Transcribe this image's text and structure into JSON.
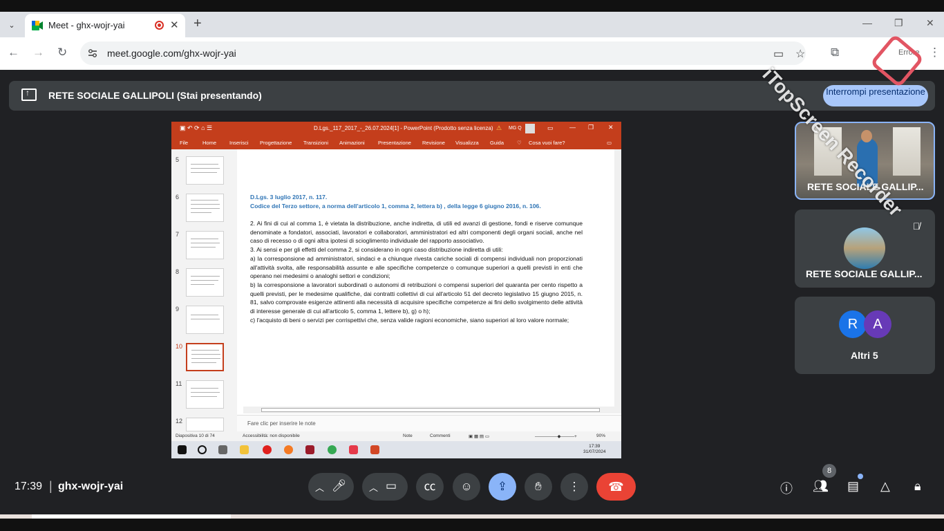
{
  "browser": {
    "tab_title": "Meet - ghx-wojr-yai",
    "url": "meet.google.com/ghx-wojr-yai",
    "profile_label": "Errore"
  },
  "meet": {
    "presenting_banner": "RETE SOCIALE GALLIPOLI (Stai presentando)",
    "stop_presenting": "Interrompi presentazione",
    "time": "17:39",
    "meeting_code": "ghx-wojr-yai",
    "participants_count": "8",
    "participants": [
      {
        "name": "RETE SOCIALE GALLIP..."
      },
      {
        "name": "RETE SOCIALE GALLIP..."
      }
    ],
    "others": {
      "label": "Altri 5",
      "avatars": [
        "R",
        "A"
      ]
    }
  },
  "shared_screen": {
    "window_title": "D.Lgs._117_2017_-_26.07.2024[1] - PowerPoint (Prodotto senza licenza)",
    "user_initials": "MG Q",
    "ribbon_tabs": [
      "File",
      "Home",
      "Inserisci",
      "Progettazione",
      "Transizioni",
      "Animazioni",
      "Presentazione",
      "Revisione",
      "Visualizza",
      "Guida",
      "Cosa vuoi fare?"
    ],
    "thumb_numbers": [
      "5",
      "6",
      "7",
      "8",
      "9",
      "10",
      "11",
      "12"
    ],
    "slide_heading_1": "D.Lgs. 3 luglio 2017, n. 117.",
    "slide_heading_2": "Codice del Terzo settore, a norma dell'articolo 1, comma 2, lettera b) , della legge 6 giugno 2016, n. 106.",
    "slide_body": [
      "2. Ai fini di cui al comma 1, è vietata la distribuzione, anche indiretta, di utili ed avanzi di gestione, fondi e riserve comunque denominate a fondatori, associati, lavoratori e collaboratori, amministratori ed altri componenti degli organi sociali, anche nel caso di recesso o di ogni altra ipotesi di scioglimento individuale del rapporto associativo.",
      "3. Ai sensi e per gli effetti del comma 2, si considerano in ogni caso distribuzione indiretta di utili:",
      "a) la corresponsione ad amministratori, sindaci e a chiunque rivesta cariche sociali di compensi individuali non proporzionati all'attività svolta, alle responsabilità assunte e alle specifiche competenze o comunque superiori a quelli previsti in enti che operano nei medesimi o analoghi settori e condizioni;",
      "b) la corresponsione a lavoratori subordinati o autonomi di retribuzioni o compensi superiori del quaranta per cento rispetto a quelli previsti, per le medesime qualifiche, dai contratti collettivi di cui all'articolo 51 del decreto legislativo 15 giugno 2015, n. 81, salvo comprovate esigenze attinenti alla necessità di acquisire specifiche competenze ai fini dello svolgimento delle attività di interesse generale di cui all'articolo 5, comma 1, lettere b), g) o h);",
      "c) l'acquisto di beni o servizi per corrispettivi che, senza valide ragioni economiche, siano superiori al loro valore normale;"
    ],
    "notes_placeholder": "Fare clic per inserire le note",
    "status_slide": "Diapositiva 10 di 74",
    "status_accessibility": "Accessibilità: non disponibile",
    "status_notes": "Note",
    "status_comments": "Commenti",
    "zoom": "90%",
    "taskbar_time": "17:39",
    "taskbar_date": "31/07/2024"
  },
  "watermark": "iTopScreen Recorder"
}
